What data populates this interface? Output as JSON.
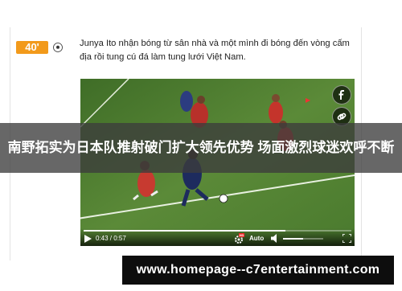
{
  "commentary": {
    "minute": "40'",
    "text": "Junya Ito nhận bóng từ sân nhà và một mình đi bóng đến vòng cấm địa rồi tung cú đá làm tung lưới Việt Nam."
  },
  "video": {
    "time": "0:43 / 0:57",
    "progress_fraction": 0.754,
    "volume_fraction": 0.5,
    "quality_label": "Auto",
    "hd_badge": "HD",
    "corner_logo": "▶"
  },
  "overlay": {
    "title": "南野拓实为日本队推射破门扩大领先优势 场面激烈球迷欢呼不断"
  },
  "banner": {
    "url": "www.homepage--c7entertainment.com"
  },
  "colors": {
    "accent": "#f29a1b",
    "pitch": "#4a7a2e",
    "overlay": "#3c3c3c",
    "banner": "#0d0d0d"
  }
}
